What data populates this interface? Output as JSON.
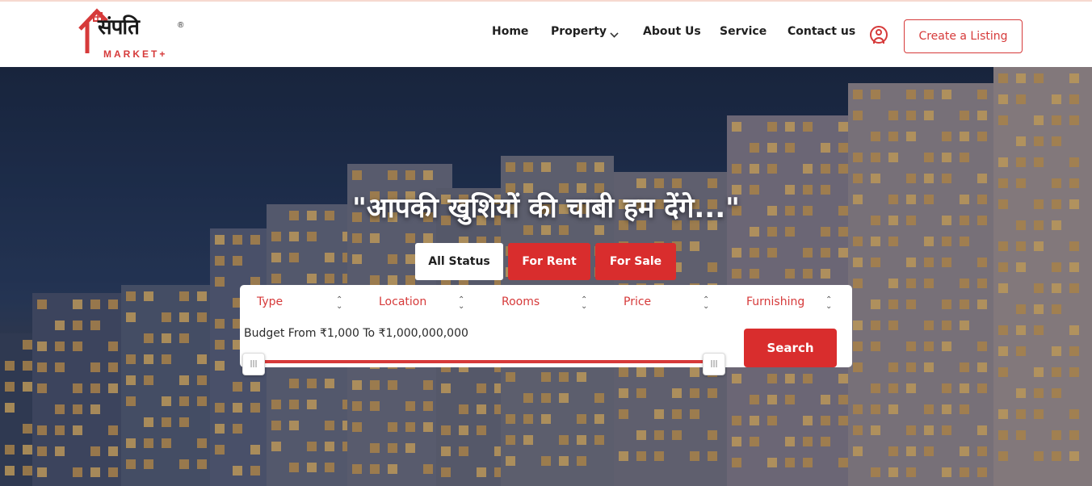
{
  "brand": {
    "logo_main": "संपति",
    "logo_sub": "MARKET+",
    "logo_reg": "®"
  },
  "nav": {
    "home": "Home",
    "property": "Property",
    "about": "About Us",
    "service": "Service",
    "contact": "Contact us",
    "create_listing": "Create a Listing"
  },
  "hero": {
    "headline": "\"आपकी खुशियों की चाबी हम देंगे...\""
  },
  "status_tabs": {
    "all": "All Status",
    "rent": "For Rent",
    "sale": "For Sale",
    "selected": "All Status"
  },
  "filters": {
    "type": "Type",
    "location": "Location",
    "rooms": "Rooms",
    "price": "Price",
    "furnishing": "Furnishing"
  },
  "budget": {
    "label": "Budget From ₹1,000 To ₹1,000,000,000",
    "min": 1000,
    "max": 1000000000,
    "selected_min": 1000,
    "selected_max": 1000000000
  },
  "search": {
    "button": "Search"
  },
  "colors": {
    "accent": "#d92d2d",
    "text_dark": "#1f1f1f"
  }
}
